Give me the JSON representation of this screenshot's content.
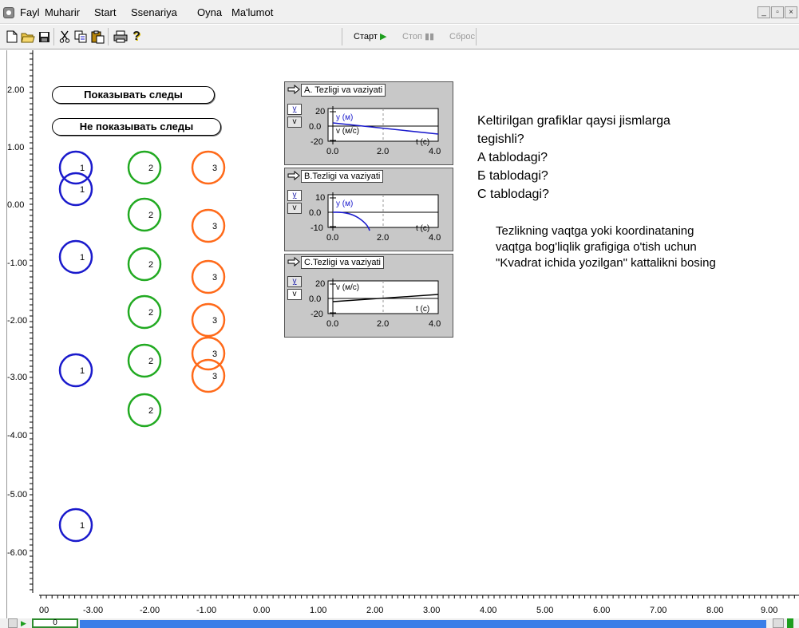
{
  "menu": {
    "fayl": "Fayl",
    "muharir": "Muharir",
    "start": "Start",
    "ssenariya": "Ssenariya",
    "oyna": "Oyna",
    "malumot": "Ma'lumot"
  },
  "toolbar": {
    "start_label": "Старт",
    "stop_label": "Стоп",
    "reset_label": "Сброс"
  },
  "buttons": {
    "show_traces": "Показывать следы",
    "hide_traces": "Не показывать следы"
  },
  "rulers": {
    "y_labels": [
      "2.00",
      "1.00",
      "0.00",
      "-1.00",
      "-2.00",
      "-3.00",
      "-4.00",
      "-5.00",
      "-6.00"
    ],
    "x_labels": [
      "00",
      "-3.00",
      "-2.00",
      "-1.00",
      "0.00",
      "1.00",
      "2.00",
      "3.00",
      "4.00",
      "5.00",
      "6.00",
      "7.00",
      "8.00",
      "9.00"
    ]
  },
  "objects": {
    "blue_label": "1",
    "green_label": "2",
    "orange_label": "3"
  },
  "panels": [
    {
      "title": "A. Tezligi va vaziyati",
      "tab_y": "y",
      "tab_v": "v",
      "y_ticks": [
        "20",
        "0.0",
        "-20"
      ],
      "x_ticks": [
        "0.0",
        "2.0",
        "4.0"
      ],
      "series_y_label": "y (м)",
      "series_v_label": "v (м/с)",
      "x_label": "t (c)"
    },
    {
      "title": "B.Tezligi va vaziyati",
      "tab_y": "y",
      "tab_v": "v",
      "y_ticks": [
        "10",
        "0.0",
        "-10"
      ],
      "x_ticks": [
        "0.0",
        "2.0",
        "4.0"
      ],
      "series_y_label": "y (м)",
      "x_label": "t (c)"
    },
    {
      "title": "C.Tezligi va vaziyati",
      "tab_y": "y",
      "tab_v": "v",
      "y_ticks": [
        "20",
        "0.0",
        "-20"
      ],
      "x_ticks": [
        "0.0",
        "2.0",
        "4.0"
      ],
      "series_v_label": "v (м/с)",
      "x_label": "t (c)"
    }
  ],
  "question": {
    "line1": "Keltirilgan grafiklar qaysi jismlarga",
    "line2": "tegishli?",
    "line3": "A tablodagi?",
    "line4": "Б tablodagi?",
    "line5": "С tablodagi?"
  },
  "instruction": {
    "line1": "Tezlikning vaqtga  yoki koordinataning",
    "line2": "vaqtga bog'liqlik grafigiga o'tish uchun",
    "line3": "\"Kvadrat ichida yozilgan\" kattalikni bosing"
  },
  "status": {
    "frame": "0"
  },
  "colors": {
    "blue": "#1a1acc",
    "green": "#22aa22",
    "orange": "#ff6a1a",
    "progress": "#3a7ee8"
  }
}
